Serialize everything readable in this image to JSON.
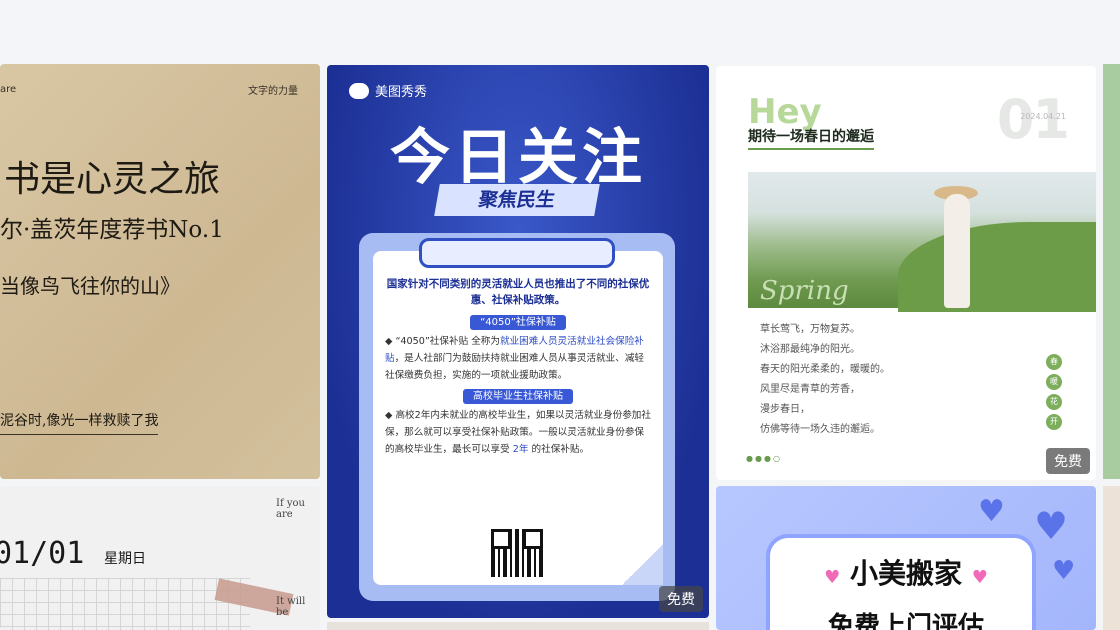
{
  "badges": {
    "free": "免费"
  },
  "card_book": {
    "top_left": "are",
    "top_right": "文字的力量",
    "line1": "书是心灵之旅",
    "line2": "尔·盖茨年度荐书No.1",
    "line3": "当像鸟飞往你的山》",
    "line4": "泥谷时,像光一样救赎了我"
  },
  "card_policy": {
    "brand": "美图秀秀",
    "headline": "今日关注",
    "tag": "聚焦民生",
    "lead": "国家针对不同类别的灵活就业人员也推出了不同的社保优惠、社保补贴政策。",
    "section1": "“4050”社保补贴",
    "para1_a": "“4050”社保补贴 全称为",
    "para1_b": "就业困难人员灵活就业社会保险补贴",
    "para1_c": "，是人社部门为鼓励扶持就业困难人员从事灵活就业、减轻社保缴费负担，实施的一项就业援助政策。",
    "section2": "高校毕业生社保补贴",
    "para2_a": "高校2年内未就业的高校毕业生，如果以灵活就业身份参加社保，那么就可以享受社保补贴政策。一般以灵活就业身份参保的高校毕业生，最长可以享受",
    "para2_b": "2年",
    "para2_c": "的社保补贴。"
  },
  "card_spring": {
    "hey": "Hey",
    "subtitle": "期待一场春日的邂逅",
    "number": "01",
    "date": "2024.04.21",
    "script": "Spring",
    "poem": [
      "草长莺飞，万物复苏。",
      "沐浴那最纯净的阳光。",
      "春天的阳光柔柔的，暖暖的。",
      "风里尽是青草的芳香，",
      "漫步春日，",
      "仿佛等待一场久违的邂逅。"
    ],
    "seal": [
      "春",
      "暖",
      "花",
      "开"
    ],
    "dots": "●●●○"
  },
  "card_calendar": {
    "date": "01/01",
    "weekday": "星期日",
    "text_top": "If you are",
    "text_bottom": "It will be"
  },
  "card_move": {
    "title": "小美搬家",
    "subtitle": "免费上门评估"
  }
}
